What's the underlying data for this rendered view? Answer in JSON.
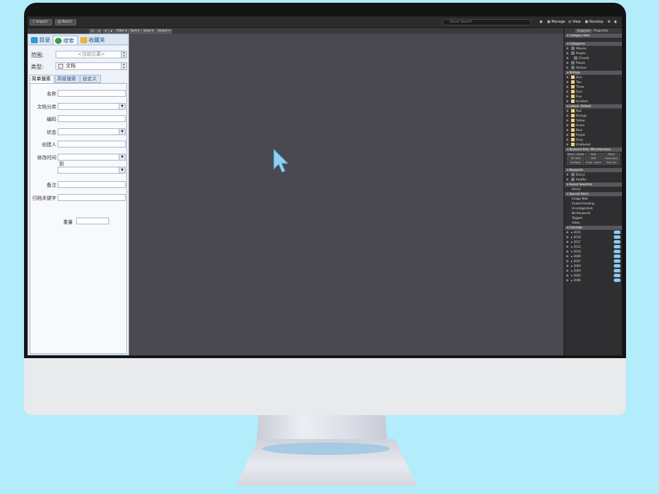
{
  "toolbar": {
    "import_label": "Import",
    "batch_label": "Batch",
    "search_placeholder": "Quick Search",
    "manage_label": "Manage",
    "view_label": "View",
    "develop_label": "Develop"
  },
  "subbar": {
    "favorites_label": "Favorites",
    "filter_label": "Filter",
    "sort_label": "Sort",
    "view_label": "View",
    "select_label": "Select"
  },
  "left_panel": {
    "tabs": [
      {
        "label": "目录",
        "color": "#2e9bd6"
      },
      {
        "label": "搜索",
        "color": "#3f9b4e"
      },
      {
        "label": "收藏夹",
        "color": "#e8b53b"
      }
    ],
    "scope_label": "范围:",
    "scope_value": "<当前位置>",
    "type_label": "类型:",
    "type_value": "文档",
    "sub_tabs": [
      "简单搜索",
      "高级搜索",
      "自定义"
    ],
    "fields": {
      "name": "名称",
      "doc_category": "文档分类",
      "code": "编码",
      "status": "状态",
      "creator": "创建人",
      "modified_time": "修改时间",
      "to": "到",
      "remark": "备注",
      "archive_keyword": "归档关键字",
      "weight": "重量"
    },
    "reset_label": "重置",
    "search_label": "搜索"
  },
  "right_panel": {
    "tabs": [
      "Organize",
      "Properties"
    ],
    "sections": {
      "category_sets": "Category Sets",
      "categories": "Categories",
      "ratings": "Ratings",
      "labels": "Labels: Default",
      "keyword_sets": "Keyword Sets: Miscellaneous",
      "keywords": "Keywords",
      "saved_searches": "Saved Searches",
      "special_items": "Special Items",
      "calendar": "Calendar"
    },
    "categories": [
      "Albums",
      "People",
      "Friends",
      "Places",
      "Various"
    ],
    "ratings": [
      "One",
      "Two",
      "Three",
      "Four",
      "Five",
      "Unrated"
    ],
    "labels": [
      {
        "name": "Red",
        "color": "#f2d27a"
      },
      {
        "name": "Orange",
        "color": "#f2d27a"
      },
      {
        "name": "Yellow",
        "color": "#f2d27a"
      },
      {
        "name": "Green",
        "color": "#f2d27a"
      },
      {
        "name": "Blue",
        "color": "#f2d27a"
      },
      {
        "name": "Purple",
        "color": "#f2d27a"
      },
      {
        "name": "Gray",
        "color": "#f2d27a"
      },
      {
        "name": "Unlabeled",
        "color": "#f2d27a"
      }
    ],
    "keyword_set": [
      "Black...White",
      "Pets",
      "Stock",
      "Tilt Shift",
      "HDR",
      "Panorama",
      "Holidays",
      "Long...osure",
      "Pixel Art"
    ],
    "keywords": [
      "Darryl",
      "Seattle"
    ],
    "saved_searches": [
      "Darryl"
    ],
    "special_items": [
      "Image Well",
      "Embed Pending",
      "Uncategorized",
      "No Keywords",
      "Tagged",
      "Video"
    ],
    "calendar_years": [
      "2015",
      "2016",
      "2017",
      "2012",
      "2010",
      "2009",
      "2007",
      "2004",
      "2005",
      "2002",
      "2006"
    ]
  }
}
